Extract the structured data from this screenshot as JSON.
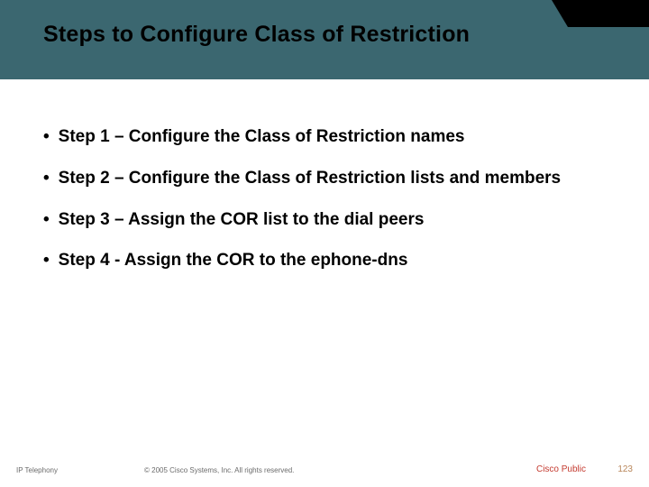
{
  "title": "Steps to Configure Class of Restriction",
  "bullets": [
    "Step 1 – Configure the Class of Restriction names",
    "Step 2 – Configure the Class of Restriction lists and members",
    "Step 3 – Assign the COR list to the dial peers",
    "Step 4 - Assign the COR to the ephone-dns"
  ],
  "footer": {
    "left": "IP Telephony",
    "center": "© 2005 Cisco Systems, Inc. All rights reserved.",
    "label": "Cisco Public",
    "page": "123"
  }
}
